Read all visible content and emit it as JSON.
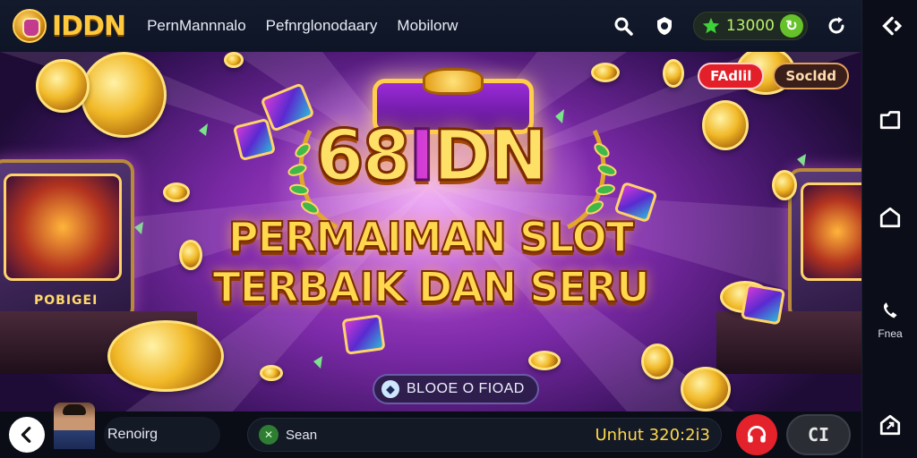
{
  "header": {
    "logo_text": "IDDN",
    "nav": [
      "PernMannnalo",
      "Pefnrglonodaary",
      "Mobilorw"
    ],
    "balance": "13000"
  },
  "hero": {
    "badges": [
      "FAdlil",
      "Socldd"
    ],
    "title_main": "68",
    "title_accent": "I",
    "title_end": "DN",
    "subtitle_line1": "PERMAIMAN SLOT",
    "subtitle_line2": "TERBAIK DAN SERU",
    "machine_label": "POBIGEI",
    "promo_text": "BLOOE O FIOAD"
  },
  "bottom": {
    "user_name": "Renoirg",
    "status_label": "Sean",
    "timer_text": "Unhut 320:2i3",
    "right_button_label": "CI"
  },
  "rail": {
    "labels": [
      "Fnea"
    ]
  },
  "colors": {
    "accent_gold": "#ffd84d",
    "brand_purple": "#c04fd8",
    "badge_red": "#e3202a",
    "balance_green": "#b8f06a"
  },
  "icons": {
    "topbar": [
      "search-icon",
      "shield-icon",
      "star-icon",
      "refresh-icon"
    ],
    "rail": [
      "chevron-share-icon",
      "tab-icon",
      "home-icon",
      "support-icon",
      "exit-icon"
    ]
  }
}
